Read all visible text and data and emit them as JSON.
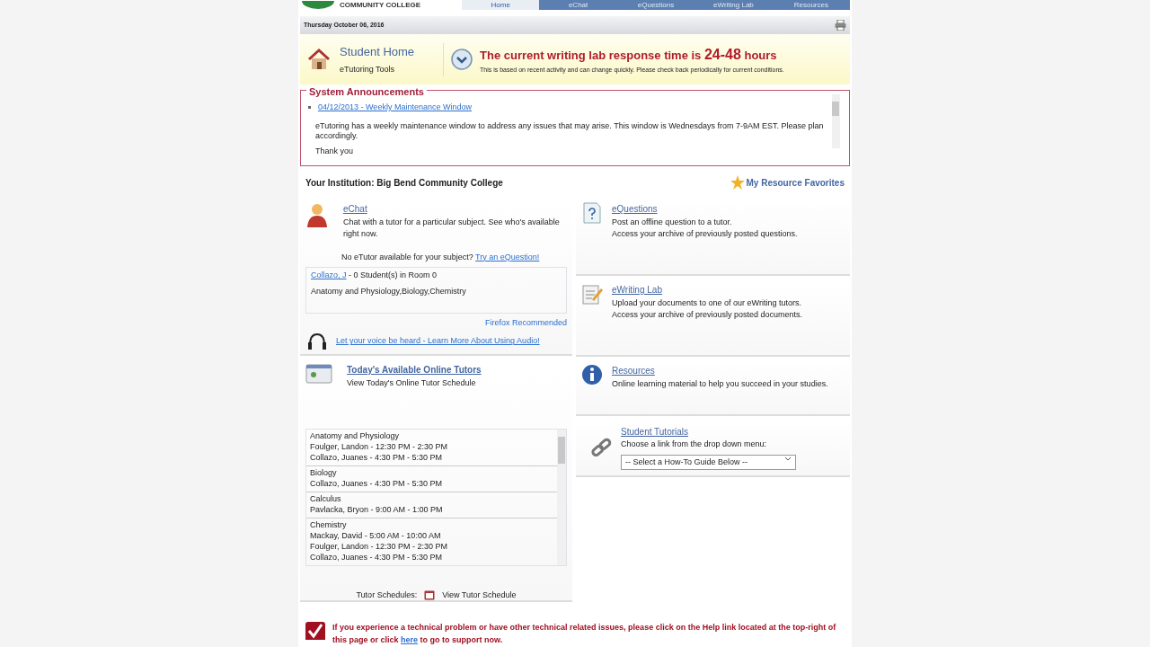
{
  "header": {
    "logo_text": "COMMUNITY COLLEGE",
    "tabs": [
      {
        "label": "Home",
        "selected": true
      },
      {
        "label": "eChat",
        "selected": false
      },
      {
        "label": "eQuestions",
        "selected": false
      },
      {
        "label": "eWriting Lab",
        "selected": false
      },
      {
        "label": "Resources",
        "selected": false
      }
    ]
  },
  "date": "Thursday October 06, 2016",
  "student_home": {
    "title": "Student Home",
    "subtitle": "eTutoring Tools"
  },
  "response_time": {
    "prefix": "The current writing lab response time is",
    "value": "24-48",
    "suffix": "hours",
    "note": "This is based on recent activity and can change quickly. Please check back periodically for current conditions."
  },
  "announcements": {
    "title": "System Announcements",
    "items": [
      {
        "link": "04/12/2013 - Weekly Maintenance Window",
        "body": "eTutoring has a weekly maintenance window to address any issues that may arise.  This window is Wednesdays from 7-9AM EST.  Please plan accordingly.",
        "closing": "Thank you"
      }
    ]
  },
  "institution": "Your Institution: Big Bend Community College",
  "favorites": "My Resource Favorites",
  "echat": {
    "title": "eChat",
    "description": "Chat with a tutor for a particular subject. See who's available right now.",
    "prompt": "No eTutor available for your subject?",
    "prompt_link": "Try an eQuestion!",
    "rooms": [
      {
        "tutor": "Collazo, J",
        "status": " - 0 Student(s) in Room 0",
        "subjects": "Anatomy and Physiology,Biology,Chemistry"
      }
    ],
    "browser_note": "Firefox Recommended",
    "audio_link": "Let your voice be heard - Learn More About Using Audio!"
  },
  "tutors": {
    "title": "Today's Available Online Tutors",
    "subtitle": "View Today's Online Tutor Schedule",
    "groups": [
      {
        "subject": "Anatomy and Physiology",
        "entries": [
          "Foulger, Landon - 12:30 PM - 2:30 PM",
          "Collazo, Juanes - 4:30 PM - 5:30 PM"
        ]
      },
      {
        "subject": "Biology",
        "entries": [
          "Collazo, Juanes - 4:30 PM - 5:30 PM"
        ]
      },
      {
        "subject": "Calculus",
        "entries": [
          "Pavlacka, Bryon - 9:00 AM - 1:00 PM"
        ]
      },
      {
        "subject": "Chemistry",
        "entries": [
          "Mackay, David - 5:00 AM - 10:00 AM",
          "Foulger, Landon - 12:30 PM - 2:30 PM",
          "Collazo, Juanes - 4:30 PM - 5:30 PM"
        ]
      }
    ],
    "footer_label": "Tutor Schedules:",
    "footer_link": "View Tutor Schedule"
  },
  "tools": [
    {
      "kind": "equestions",
      "title": "eQuestions",
      "lines": [
        "Post an offline question to a tutor.",
        "Access your archive of previously posted questions."
      ]
    },
    {
      "kind": "ewriting",
      "title": "eWriting Lab",
      "lines": [
        "Upload your documents to one of our eWriting tutors.",
        "Access your archive of previously posted documents."
      ]
    },
    {
      "kind": "resources",
      "title": "Resources",
      "lines": [
        "Online learning material to help you succeed in your studies."
      ]
    },
    {
      "kind": "tutorials",
      "title": "Student Tutorials",
      "lines": [
        "Choose a link from the drop down menu:"
      ],
      "select": "-- Select a How-To Guide Below --"
    }
  ],
  "support": {
    "before": "If you experience a technical problem or have other technical related issues, please click on the Help link located at the top-right of this page or click",
    "link": "here",
    "after": "to go to support now."
  }
}
